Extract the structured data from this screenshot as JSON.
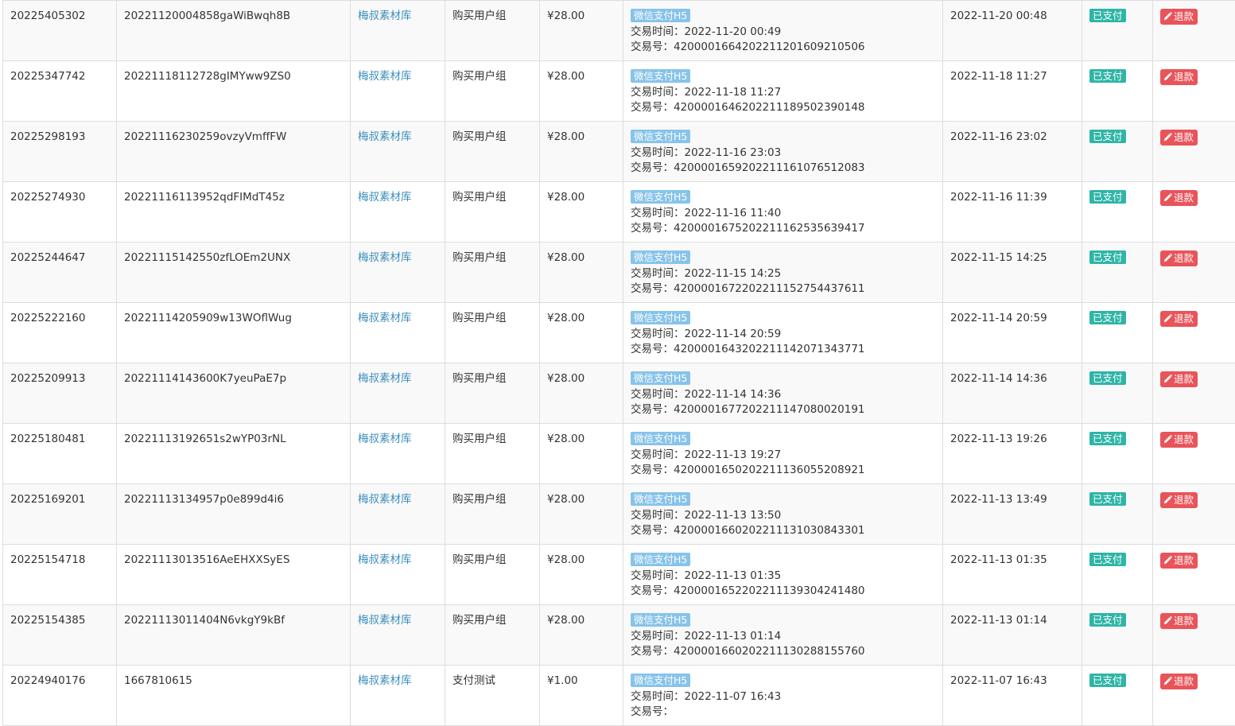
{
  "labels": {
    "trade_time": "交易时间：",
    "trade_no": "交易号：",
    "refund": "退款"
  },
  "rows": [
    {
      "id": "20225405302",
      "order_no": "20221120004858gaWiBwqh8B",
      "site": "梅叔素材库",
      "type": "购买用户组",
      "amount": "¥28.00",
      "pay_method": "微信支付H5",
      "trade_time": "2022-11-20 00:49",
      "trade_no": "4200001664202211201609210506",
      "created": "2022-11-20 00:48",
      "status": "已支付"
    },
    {
      "id": "20225347742",
      "order_no": "20221118112728gIMYww9ZS0",
      "site": "梅叔素材库",
      "type": "购买用户组",
      "amount": "¥28.00",
      "pay_method": "微信支付H5",
      "trade_time": "2022-11-18 11:27",
      "trade_no": "4200001646202211189502390148",
      "created": "2022-11-18 11:27",
      "status": "已支付"
    },
    {
      "id": "20225298193",
      "order_no": "20221116230259ovzyVmffFW",
      "site": "梅叔素材库",
      "type": "购买用户组",
      "amount": "¥28.00",
      "pay_method": "微信支付H5",
      "trade_time": "2022-11-16 23:03",
      "trade_no": "4200001659202211161076512083",
      "created": "2022-11-16 23:02",
      "status": "已支付"
    },
    {
      "id": "20225274930",
      "order_no": "20221116113952qdFIMdT45z",
      "site": "梅叔素材库",
      "type": "购买用户组",
      "amount": "¥28.00",
      "pay_method": "微信支付H5",
      "trade_time": "2022-11-16 11:40",
      "trade_no": "4200001675202211162535639417",
      "created": "2022-11-16 11:39",
      "status": "已支付"
    },
    {
      "id": "20225244647",
      "order_no": "20221115142550zfLOEm2UNX",
      "site": "梅叔素材库",
      "type": "购买用户组",
      "amount": "¥28.00",
      "pay_method": "微信支付H5",
      "trade_time": "2022-11-15 14:25",
      "trade_no": "4200001672202211152754437611",
      "created": "2022-11-15 14:25",
      "status": "已支付"
    },
    {
      "id": "20225222160",
      "order_no": "20221114205909w13WOflWug",
      "site": "梅叔素材库",
      "type": "购买用户组",
      "amount": "¥28.00",
      "pay_method": "微信支付H5",
      "trade_time": "2022-11-14 20:59",
      "trade_no": "4200001643202211142071343771",
      "created": "2022-11-14 20:59",
      "status": "已支付"
    },
    {
      "id": "20225209913",
      "order_no": "20221114143600K7yeuPaE7p",
      "site": "梅叔素材库",
      "type": "购买用户组",
      "amount": "¥28.00",
      "pay_method": "微信支付H5",
      "trade_time": "2022-11-14 14:36",
      "trade_no": "4200001677202211147080020191",
      "created": "2022-11-14 14:36",
      "status": "已支付"
    },
    {
      "id": "20225180481",
      "order_no": "20221113192651s2wYP03rNL",
      "site": "梅叔素材库",
      "type": "购买用户组",
      "amount": "¥28.00",
      "pay_method": "微信支付H5",
      "trade_time": "2022-11-13 19:27",
      "trade_no": "4200001650202211136055208921",
      "created": "2022-11-13 19:26",
      "status": "已支付"
    },
    {
      "id": "20225169201",
      "order_no": "20221113134957p0e899d4i6",
      "site": "梅叔素材库",
      "type": "购买用户组",
      "amount": "¥28.00",
      "pay_method": "微信支付H5",
      "trade_time": "2022-11-13 13:50",
      "trade_no": "4200001660202211131030843301",
      "created": "2022-11-13 13:49",
      "status": "已支付"
    },
    {
      "id": "20225154718",
      "order_no": "20221113013516AeEHXXSyES",
      "site": "梅叔素材库",
      "type": "购买用户组",
      "amount": "¥28.00",
      "pay_method": "微信支付H5",
      "trade_time": "2022-11-13 01:35",
      "trade_no": "4200001652202211139304241480",
      "created": "2022-11-13 01:35",
      "status": "已支付"
    },
    {
      "id": "20225154385",
      "order_no": "20221113011404N6vkgY9kBf",
      "site": "梅叔素材库",
      "type": "购买用户组",
      "amount": "¥28.00",
      "pay_method": "微信支付H5",
      "trade_time": "2022-11-13 01:14",
      "trade_no": "4200001660202211130288155760",
      "created": "2022-11-13 01:14",
      "status": "已支付"
    },
    {
      "id": "20224940176",
      "order_no": "1667810615",
      "site": "梅叔素材库",
      "type": "支付测试",
      "amount": "¥1.00",
      "pay_method": "微信支付H5",
      "trade_time": "2022-11-07 16:43",
      "trade_no": "",
      "created": "2022-11-07 16:43",
      "status": "已支付"
    }
  ]
}
